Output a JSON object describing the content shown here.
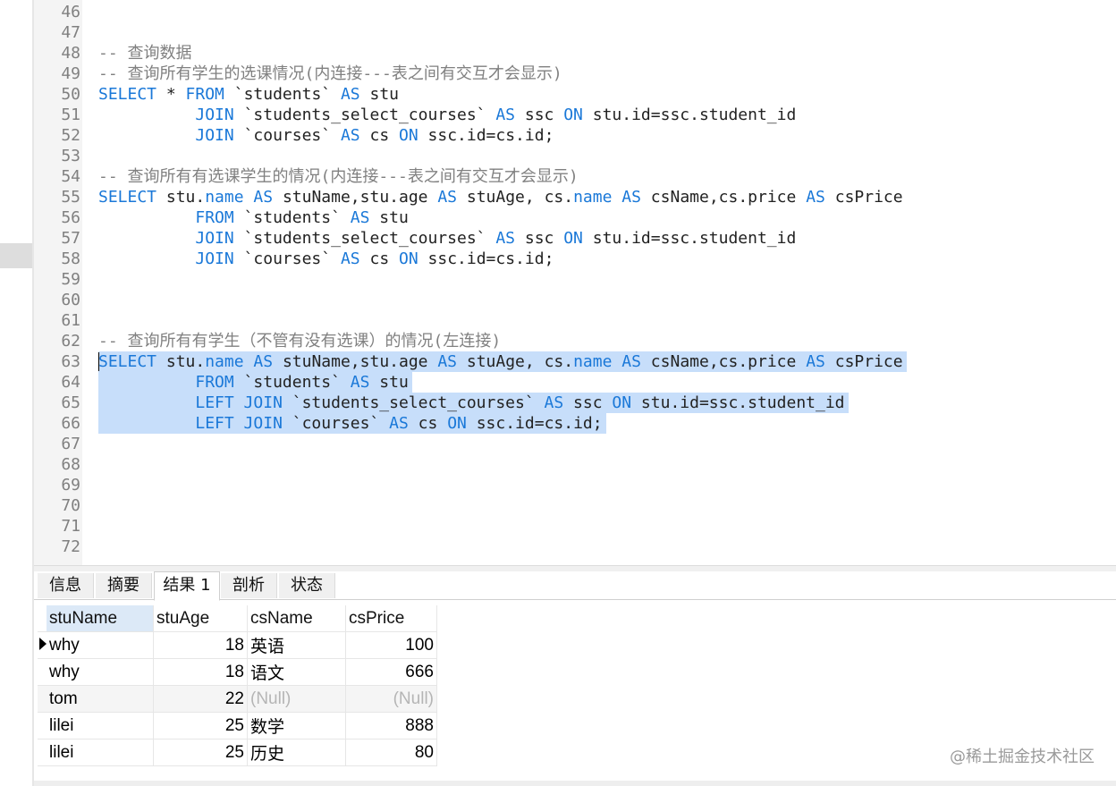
{
  "editor": {
    "lines": [
      {
        "n": "46",
        "parts": []
      },
      {
        "n": "47",
        "parts": []
      },
      {
        "n": "48",
        "parts": [
          {
            "t": "cm",
            "v": "-- 查询数据"
          }
        ]
      },
      {
        "n": "49",
        "parts": [
          {
            "t": "cm",
            "v": "-- 查询所有学生的选课情况(内连接---表之间有交互才会显示)"
          }
        ]
      },
      {
        "n": "50",
        "parts": [
          {
            "t": "kw",
            "v": "SELECT"
          },
          {
            "t": "tx",
            "v": " * "
          },
          {
            "t": "kw",
            "v": "FROM"
          },
          {
            "t": "tx",
            "v": " `students` "
          },
          {
            "t": "kw",
            "v": "AS"
          },
          {
            "t": "tx",
            "v": " stu"
          }
        ]
      },
      {
        "n": "51",
        "parts": [
          {
            "t": "tx",
            "v": "          "
          },
          {
            "t": "kw",
            "v": "JOIN"
          },
          {
            "t": "tx",
            "v": " `students_select_courses` "
          },
          {
            "t": "kw",
            "v": "AS"
          },
          {
            "t": "tx",
            "v": " ssc "
          },
          {
            "t": "kw",
            "v": "ON"
          },
          {
            "t": "tx",
            "v": " stu.id=ssc.student_id"
          }
        ]
      },
      {
        "n": "52",
        "parts": [
          {
            "t": "tx",
            "v": "          "
          },
          {
            "t": "kw",
            "v": "JOIN"
          },
          {
            "t": "tx",
            "v": " `courses` "
          },
          {
            "t": "kw",
            "v": "AS"
          },
          {
            "t": "tx",
            "v": " cs "
          },
          {
            "t": "kw",
            "v": "ON"
          },
          {
            "t": "tx",
            "v": " ssc.id=cs.id;"
          }
        ]
      },
      {
        "n": "53",
        "parts": []
      },
      {
        "n": "54",
        "parts": [
          {
            "t": "cm",
            "v": "-- 查询所有有选课学生的情况(内连接---表之间有交互才会显示)"
          }
        ]
      },
      {
        "n": "55",
        "parts": [
          {
            "t": "kw",
            "v": "SELECT"
          },
          {
            "t": "tx",
            "v": " stu."
          },
          {
            "t": "kw",
            "v": "name"
          },
          {
            "t": "tx",
            "v": " "
          },
          {
            "t": "kw",
            "v": "AS"
          },
          {
            "t": "tx",
            "v": " stuName,stu.age "
          },
          {
            "t": "kw",
            "v": "AS"
          },
          {
            "t": "tx",
            "v": " stuAge, cs."
          },
          {
            "t": "kw",
            "v": "name"
          },
          {
            "t": "tx",
            "v": " "
          },
          {
            "t": "kw",
            "v": "AS"
          },
          {
            "t": "tx",
            "v": " csName,cs.price "
          },
          {
            "t": "kw",
            "v": "AS"
          },
          {
            "t": "tx",
            "v": " csPrice"
          }
        ]
      },
      {
        "n": "56",
        "parts": [
          {
            "t": "tx",
            "v": "          "
          },
          {
            "t": "kw",
            "v": "FROM"
          },
          {
            "t": "tx",
            "v": " `students` "
          },
          {
            "t": "kw",
            "v": "AS"
          },
          {
            "t": "tx",
            "v": " stu"
          }
        ]
      },
      {
        "n": "57",
        "parts": [
          {
            "t": "tx",
            "v": "          "
          },
          {
            "t": "kw",
            "v": "JOIN"
          },
          {
            "t": "tx",
            "v": " `students_select_courses` "
          },
          {
            "t": "kw",
            "v": "AS"
          },
          {
            "t": "tx",
            "v": " ssc "
          },
          {
            "t": "kw",
            "v": "ON"
          },
          {
            "t": "tx",
            "v": " stu.id=ssc.student_id"
          }
        ]
      },
      {
        "n": "58",
        "parts": [
          {
            "t": "tx",
            "v": "          "
          },
          {
            "t": "kw",
            "v": "JOIN"
          },
          {
            "t": "tx",
            "v": " `courses` "
          },
          {
            "t": "kw",
            "v": "AS"
          },
          {
            "t": "tx",
            "v": " cs "
          },
          {
            "t": "kw",
            "v": "ON"
          },
          {
            "t": "tx",
            "v": " ssc.id=cs.id;"
          }
        ]
      },
      {
        "n": "59",
        "parts": []
      },
      {
        "n": "60",
        "parts": []
      },
      {
        "n": "61",
        "parts": []
      },
      {
        "n": "62",
        "parts": [
          {
            "t": "cm",
            "v": "-- 查询所有有学生（不管有没有选课）的情况(左连接)"
          }
        ]
      },
      {
        "n": "63",
        "parts": [
          {
            "t": "kw",
            "v": "SELECT"
          },
          {
            "t": "tx",
            "v": " stu."
          },
          {
            "t": "kw",
            "v": "name"
          },
          {
            "t": "tx",
            "v": " "
          },
          {
            "t": "kw",
            "v": "AS"
          },
          {
            "t": "tx",
            "v": " stuName,stu.age "
          },
          {
            "t": "kw",
            "v": "AS"
          },
          {
            "t": "tx",
            "v": " stuAge, cs."
          },
          {
            "t": "kw",
            "v": "name"
          },
          {
            "t": "tx",
            "v": " "
          },
          {
            "t": "kw",
            "v": "AS"
          },
          {
            "t": "tx",
            "v": " csName,cs.price "
          },
          {
            "t": "kw",
            "v": "AS"
          },
          {
            "t": "tx",
            "v": " csPrice"
          }
        ],
        "selected": true
      },
      {
        "n": "64",
        "parts": [
          {
            "t": "tx",
            "v": "          "
          },
          {
            "t": "kw",
            "v": "FROM"
          },
          {
            "t": "tx",
            "v": " `students` "
          },
          {
            "t": "kw",
            "v": "AS"
          },
          {
            "t": "tx",
            "v": " stu"
          }
        ],
        "selected": true
      },
      {
        "n": "65",
        "parts": [
          {
            "t": "tx",
            "v": "          "
          },
          {
            "t": "kw",
            "v": "LEFT JOIN"
          },
          {
            "t": "tx",
            "v": " `students_select_courses` "
          },
          {
            "t": "kw",
            "v": "AS"
          },
          {
            "t": "tx",
            "v": " ssc "
          },
          {
            "t": "kw",
            "v": "ON"
          },
          {
            "t": "tx",
            "v": " stu.id=ssc.student_id"
          }
        ],
        "selected": true
      },
      {
        "n": "66",
        "parts": [
          {
            "t": "tx",
            "v": "          "
          },
          {
            "t": "kw",
            "v": "LEFT JOIN"
          },
          {
            "t": "tx",
            "v": " `courses` "
          },
          {
            "t": "kw",
            "v": "AS"
          },
          {
            "t": "tx",
            "v": " cs "
          },
          {
            "t": "kw",
            "v": "ON"
          },
          {
            "t": "tx",
            "v": " ssc.id=cs.id;"
          }
        ],
        "selected": true
      },
      {
        "n": "67",
        "parts": []
      },
      {
        "n": "68",
        "parts": []
      },
      {
        "n": "69",
        "parts": []
      },
      {
        "n": "70",
        "parts": []
      },
      {
        "n": "71",
        "parts": []
      },
      {
        "n": "72",
        "parts": []
      }
    ]
  },
  "tabs": [
    {
      "label": "信息",
      "active": false
    },
    {
      "label": "摘要",
      "active": false
    },
    {
      "label": "结果 1",
      "active": true
    },
    {
      "label": "剖析",
      "active": false
    },
    {
      "label": "状态",
      "active": false
    }
  ],
  "results": {
    "columns": [
      "stuName",
      "stuAge",
      "csName",
      "csPrice"
    ],
    "sorted_column": "stuName",
    "rows": [
      {
        "stuName": "why",
        "stuAge": "18",
        "csName": "英语",
        "csPrice": "100",
        "current": true
      },
      {
        "stuName": "why",
        "stuAge": "18",
        "csName": "语文",
        "csPrice": "666"
      },
      {
        "stuName": "tom",
        "stuAge": "22",
        "csName": "(Null)",
        "csPrice": "(Null)"
      },
      {
        "stuName": "lilei",
        "stuAge": "25",
        "csName": "数学",
        "csPrice": "888"
      },
      {
        "stuName": "lilei",
        "stuAge": "25",
        "csName": "历史",
        "csPrice": "80"
      }
    ]
  },
  "watermark": "@稀土掘金技术社区",
  "colors": {
    "keyword": "#1a78d8",
    "comment": "#808080",
    "selection": "#c7defa"
  }
}
